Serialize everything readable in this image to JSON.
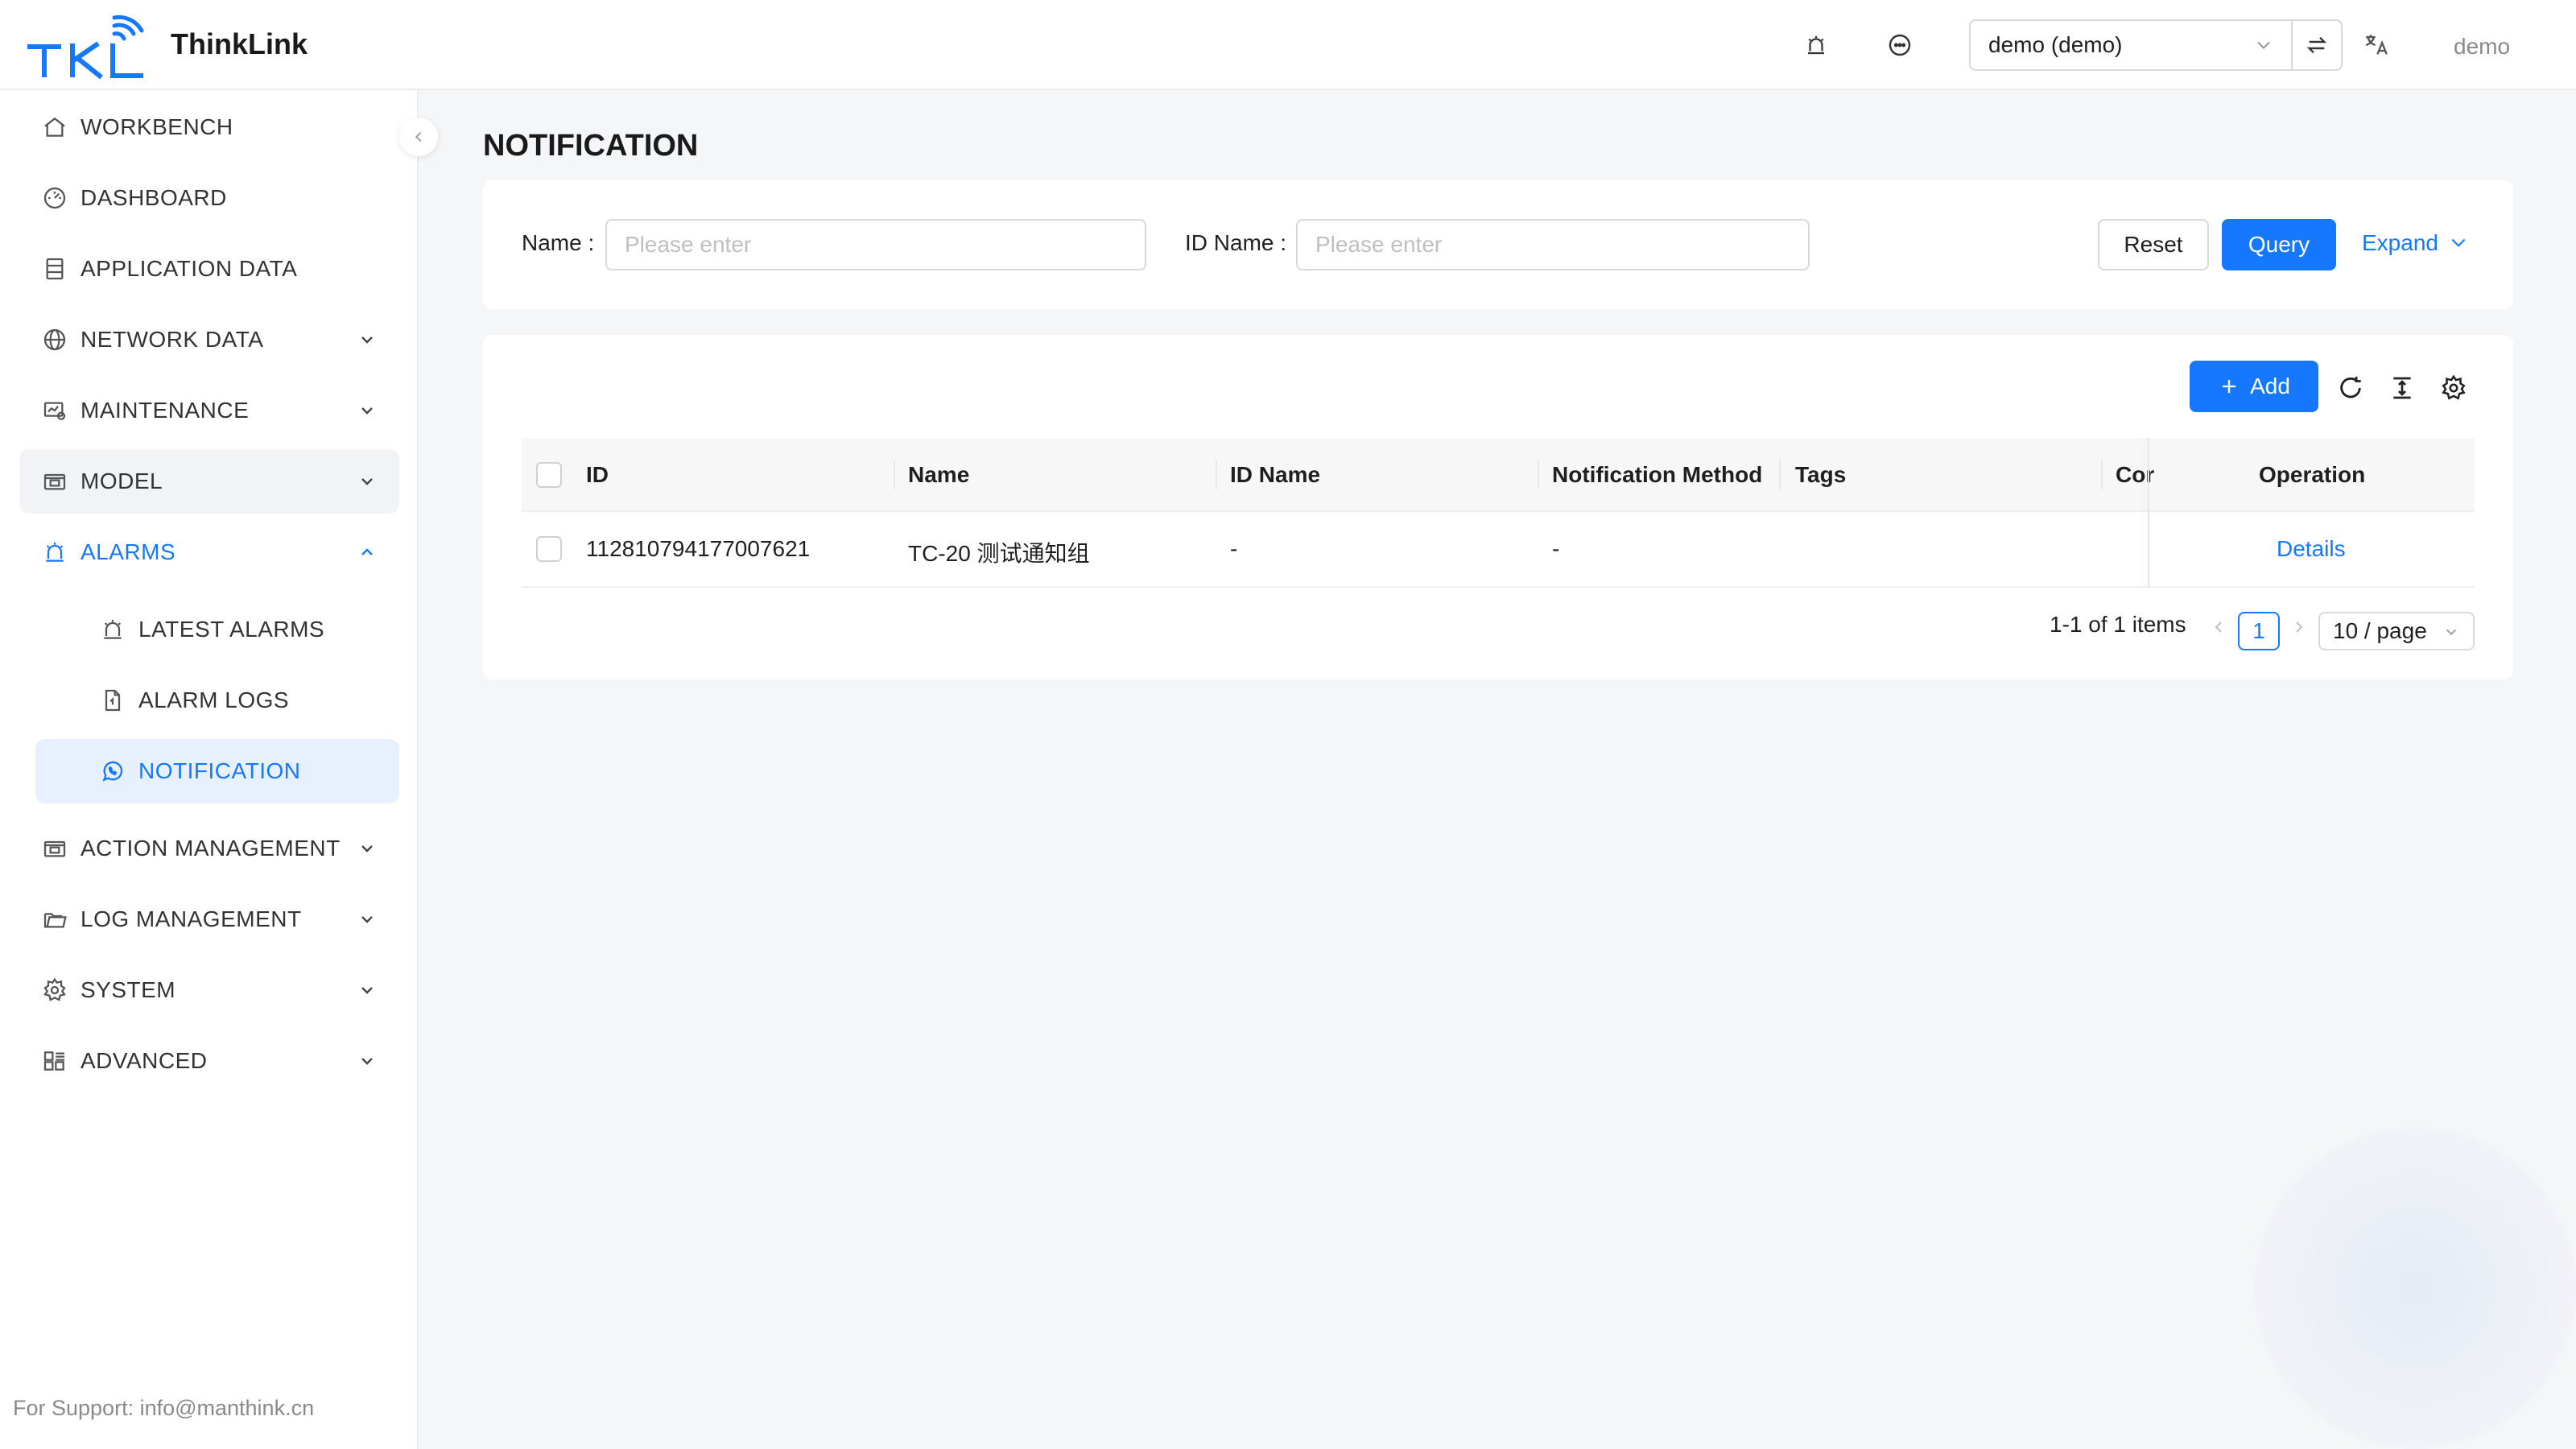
{
  "header": {
    "app_title": "ThinkLink",
    "tenant_value": "demo (demo)",
    "user_name": "demo",
    "icons": [
      "alarm-icon",
      "message-icon",
      "chevron-down-icon",
      "swap-icon",
      "translate-icon"
    ]
  },
  "sidebar": {
    "items": [
      {
        "label": "WORKBENCH",
        "icon": "home-icon"
      },
      {
        "label": "DASHBOARD",
        "icon": "dashboard-icon"
      },
      {
        "label": "APPLICATION DATA",
        "icon": "database-icon"
      },
      {
        "label": "NETWORK DATA",
        "icon": "globe-icon"
      },
      {
        "label": "MAINTENANCE",
        "icon": "maintenance-icon"
      },
      {
        "label": "MODEL",
        "icon": "model-icon"
      },
      {
        "label": "ALARMS",
        "icon": "alarm-icon"
      },
      {
        "label": "LATEST ALARMS",
        "icon": "alarm-icon"
      },
      {
        "label": "ALARM LOGS",
        "icon": "file-icon"
      },
      {
        "label": "NOTIFICATION",
        "icon": "whatsapp-icon"
      },
      {
        "label": "ACTION MANAGEMENT",
        "icon": "action-icon"
      },
      {
        "label": "LOG MANAGEMENT",
        "icon": "folder-icon"
      },
      {
        "label": "SYSTEM",
        "icon": "gear-icon"
      },
      {
        "label": "ADVANCED",
        "icon": "apps-icon"
      }
    ],
    "support": "For Support: info@manthink.cn"
  },
  "main": {
    "title": "NOTIFICATION",
    "search": {
      "name_label": "Name",
      "name_placeholder": "Please enter",
      "id_name_label": "ID Name",
      "id_name_placeholder": "Please enter",
      "reset_label": "Reset",
      "query_label": "Query",
      "expand_label": "Expand"
    },
    "toolbar": {
      "add_label": "Add",
      "icons": [
        "refresh-icon",
        "density-icon",
        "settings-icon"
      ]
    },
    "table": {
      "columns": [
        "ID",
        "Name",
        "ID Name",
        "Notification Method",
        "Tags",
        "Cor",
        "Operation"
      ],
      "rows": [
        {
          "id": "112810794177007621",
          "name": "TC-20 测试通知组",
          "id_name": "-",
          "method": "-",
          "tags": "",
          "cor": "",
          "operation": "Details"
        }
      ]
    },
    "pagination": {
      "summary": "1-1 of 1 items",
      "current_page": "1",
      "page_size": "10 / page"
    }
  },
  "colors": {
    "primary": "#1677ff",
    "active_bg": "#e6f1fd",
    "page_bg": "#f5f6f8"
  }
}
